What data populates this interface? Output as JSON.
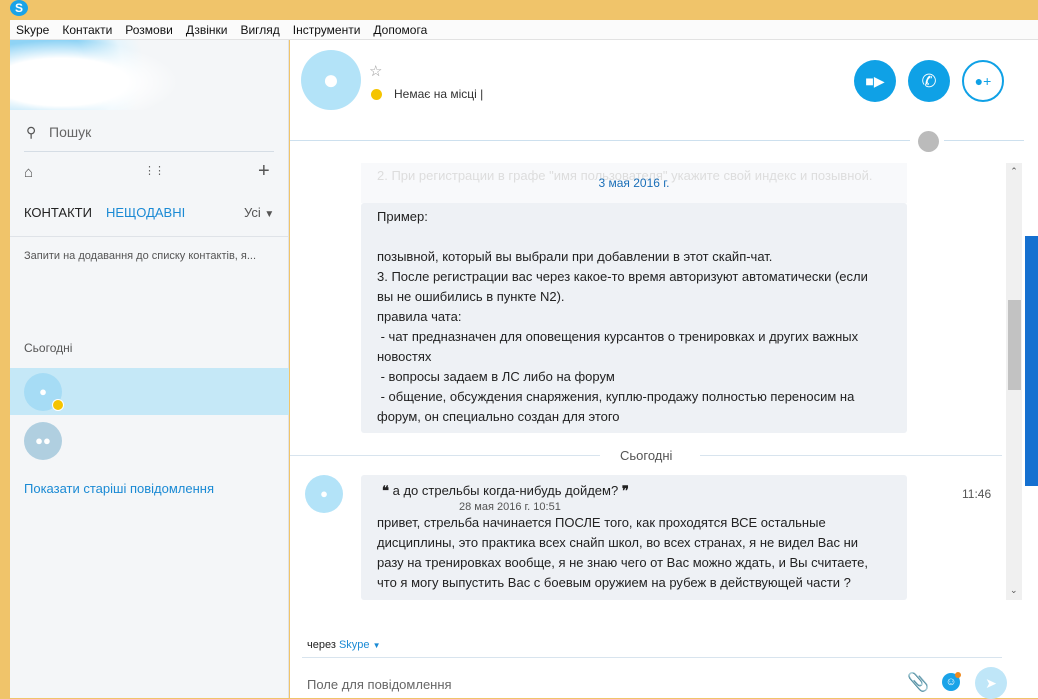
{
  "menu": [
    "Skype",
    "Контакти",
    "Розмови",
    "Дзвінки",
    "Вигляд",
    "Інструменти",
    "Допомога"
  ],
  "sidebar": {
    "search_placeholder": "Пошук",
    "tabs": {
      "contacts": "КОНТАКТИ",
      "recent": "НЕЩОДАВНІ",
      "filter": "Усі"
    },
    "requests": "Запити на додавання до списку контактів, я...",
    "today": "Сьогодні",
    "show_older": "Показати старіші повідомлення"
  },
  "header": {
    "status": "Немає на місці",
    "separator": "|"
  },
  "chat": {
    "faded_line": "2. При регистрации в графе \"имя пользователя\" укажите свой индекс и позывной.",
    "date1": "3 мая 2016 г.",
    "msg1": [
      "Пример:",
      "",
      "позывной, который вы выбрали при добавлении в этот скайп-чат.",
      "3. После регистрации вас через какое-то время авторизуют автоматически (если",
      "вы не ошибились в пункте N2).",
      "правила чата:",
      " - чат предназначен для оповещения курсантов о тренировках и других важных",
      "новостях",
      " - вопросы задаем в ЛС либо на форум",
      " - общение, обсуждения снаряжения, куплю-продажу полностью переносим на",
      "форум, он специально создан для этого"
    ],
    "date2": "Сьогодні",
    "quote": "а до стрельбы когда-нибудь дойдем?",
    "quote_meta": "28 мая 2016 г. 10:51",
    "msg2": [
      "привет, стрельба начинается ПОСЛЕ того, как проходятся ВСЕ остальные",
      "дисциплины, это практика всех снайп школ, во всех странах, я не видел Вас ни",
      "разу на тренировках вообще, я не знаю чего от Вас можно ждать, и Вы считаете,",
      "что я могу выпустить Вас с боевым оружием на рубеж в действующей части ?"
    ],
    "time2": "11:46"
  },
  "compose": {
    "via": "через",
    "via_service": "Skype",
    "placeholder": "Поле для повідомлення"
  },
  "colors": {
    "accent": "#0fa1e6",
    "away": "#f5c400",
    "selected_row": "#c5e8f7"
  }
}
